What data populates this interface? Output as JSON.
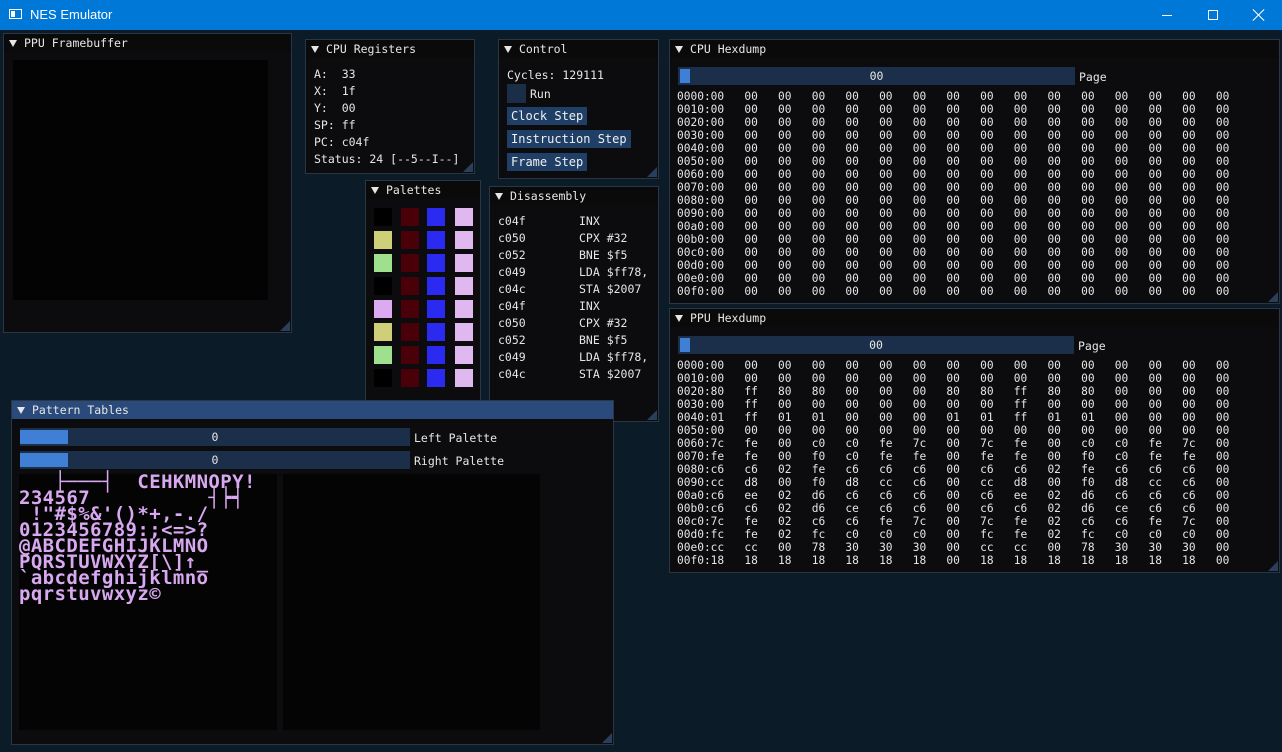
{
  "window": {
    "title": "NES Emulator"
  },
  "ppu_framebuffer": {
    "title": "PPU Framebuffer"
  },
  "cpu_registers": {
    "title": "CPU Registers",
    "lines": [
      "A:  33",
      "X:  1f",
      "Y:  00",
      "SP: ff",
      "PC: c04f",
      "Status: 24 [--5--I--]"
    ]
  },
  "control": {
    "title": "Control",
    "cycles": "Cycles: 129111",
    "run_label": "Run",
    "clock_step": "Clock Step",
    "instruction_step": "Instruction Step",
    "frame_step": "Frame Step"
  },
  "palettes": {
    "title": "Palettes",
    "colors": {
      "black": "#000000",
      "yellow": "#cfcf7a",
      "green": "#9ee08e",
      "lilac": "#dcaaf0",
      "maroon": "#4a0008",
      "blue": "#2a2af0",
      "light_lilac": "#e0b8f0"
    },
    "rows": [
      [
        "#000000",
        "#4a0008",
        "#2a2af0",
        "#e0b8f0"
      ],
      [
        "#cfcf7a",
        "#4a0008",
        "#2a2af0",
        "#e0b8f0"
      ],
      [
        "#9ee08e",
        "#4a0008",
        "#2a2af0",
        "#e0b8f0"
      ],
      [
        "#000000",
        "#4a0008",
        "#2a2af0",
        "#e0b8f0"
      ],
      [
        "#dcaaf0",
        "#4a0008",
        "#2a2af0",
        "#e0b8f0"
      ],
      [
        "#cfcf7a",
        "#4a0008",
        "#2a2af0",
        "#e0b8f0"
      ],
      [
        "#9ee08e",
        "#4a0008",
        "#2a2af0",
        "#e0b8f0"
      ],
      [
        "#000000",
        "#4a0008",
        "#2a2af0",
        "#e0b8f0"
      ]
    ]
  },
  "disassembly": {
    "title": "Disassembly",
    "rows": [
      {
        "addr": "c04f",
        "ins": "INX"
      },
      {
        "addr": "c050",
        "ins": "CPX #32"
      },
      {
        "addr": "c052",
        "ins": "BNE $f5"
      },
      {
        "addr": "c049",
        "ins": "LDA $ff78,"
      },
      {
        "addr": "c04c",
        "ins": "STA $2007"
      },
      {
        "addr": "c04f",
        "ins": "INX"
      },
      {
        "addr": "c050",
        "ins": "CPX #32"
      },
      {
        "addr": "c052",
        "ins": "BNE $f5"
      },
      {
        "addr": "c049",
        "ins": "LDA $ff78,"
      },
      {
        "addr": "c04c",
        "ins": "STA $2007"
      }
    ]
  },
  "cpu_hexdump": {
    "title": "CPU Hexdump",
    "page_value": "00",
    "page_label": "Page",
    "lines": [
      "0000:00   00   00   00   00   00   00   00   00   00   00   00   00   00   00   00",
      "0010:00   00   00   00   00   00   00   00   00   00   00   00   00   00   00   00",
      "0020:00   00   00   00   00   00   00   00   00   00   00   00   00   00   00   00",
      "0030:00   00   00   00   00   00   00   00   00   00   00   00   00   00   00   00",
      "0040:00   00   00   00   00   00   00   00   00   00   00   00   00   00   00   00",
      "0050:00   00   00   00   00   00   00   00   00   00   00   00   00   00   00   00",
      "0060:00   00   00   00   00   00   00   00   00   00   00   00   00   00   00   00",
      "0070:00   00   00   00   00   00   00   00   00   00   00   00   00   00   00   00",
      "0080:00   00   00   00   00   00   00   00   00   00   00   00   00   00   00   00",
      "0090:00   00   00   00   00   00   00   00   00   00   00   00   00   00   00   00",
      "00a0:00   00   00   00   00   00   00   00   00   00   00   00   00   00   00   00",
      "00b0:00   00   00   00   00   00   00   00   00   00   00   00   00   00   00   00",
      "00c0:00   00   00   00   00   00   00   00   00   00   00   00   00   00   00   00",
      "00d0:00   00   00   00   00   00   00   00   00   00   00   00   00   00   00   00",
      "00e0:00   00   00   00   00   00   00   00   00   00   00   00   00   00   00   00",
      "00f0:00   00   00   00   00   00   00   00   00   00   00   00   00   00   00   00"
    ]
  },
  "ppu_hexdump": {
    "title": "PPU Hexdump",
    "page_value": "00",
    "page_label": "Page",
    "lines": [
      "0000:00   00   00   00   00   00   00   00   00   00   00   00   00   00   00   00",
      "0010:00   00   00   00   00   00   00   00   00   00   00   00   00   00   00   00",
      "0020:80   ff   80   80   00   00   00   80   80   ff   80   80   00   00   00   00",
      "0030:00   ff   00   00   00   00   00   00   00   ff   00   00   00   00   00   00",
      "0040:01   ff   01   01   00   00   00   01   01   ff   01   01   00   00   00   00",
      "0050:00   00   00   00   00   00   00   00   00   00   00   00   00   00   00   00",
      "0060:7c   fe   00   c0   c0   fe   7c   00   7c   fe   00   c0   c0   fe   7c   00",
      "0070:fe   fe   00   f0   c0   fe   fe   00   fe   fe   00   f0   c0   fe   fe   00",
      "0080:c6   c6   02   fe   c6   c6   c6   00   c6   c6   02   fe   c6   c6   c6   00",
      "0090:cc   d8   00   f0   d8   cc   c6   00   cc   d8   00   f0   d8   cc   c6   00",
      "00a0:c6   ee   02   d6   c6   c6   c6   00   c6   ee   02   d6   c6   c6   c6   00",
      "00b0:c6   c6   02   d6   ce   c6   c6   00   c6   c6   02   d6   ce   c6   c6   00",
      "00c0:7c   fe   02   c6   c6   fe   7c   00   7c   fe   02   c6   c6   fe   7c   00",
      "00d0:fc   fe   02   fc   c0   c0   c0   00   fc   fe   02   fc   c0   c0   c0   00",
      "00e0:cc   cc   00   78   30   30   30   00   cc   cc   00   78   30   30   30   00",
      "00f0:18   18   18   18   18   18   18   00   18   18   18   18   18   18   18   00"
    ]
  },
  "pattern_tables": {
    "title": "Pattern Tables",
    "left_value": "0",
    "left_label": "Left Palette",
    "right_value": "0",
    "right_label": "Right Palette",
    "left_fill_fraction": 0.0,
    "right_fill_fraction": 0.0,
    "glyph_lines": [
      "   ├───┤  CEHKMNOPY!",
      "234567          ┤┝┥",
      " !\"#$%&'()*+,-./",
      "0123456789:;<=>?",
      "@ABCDEFGHIJKLMNO",
      "PQRSTUVWXYZ[\\]↑_",
      "`abcdefghijklmno",
      "pqrstuvwxyz©"
    ]
  }
}
